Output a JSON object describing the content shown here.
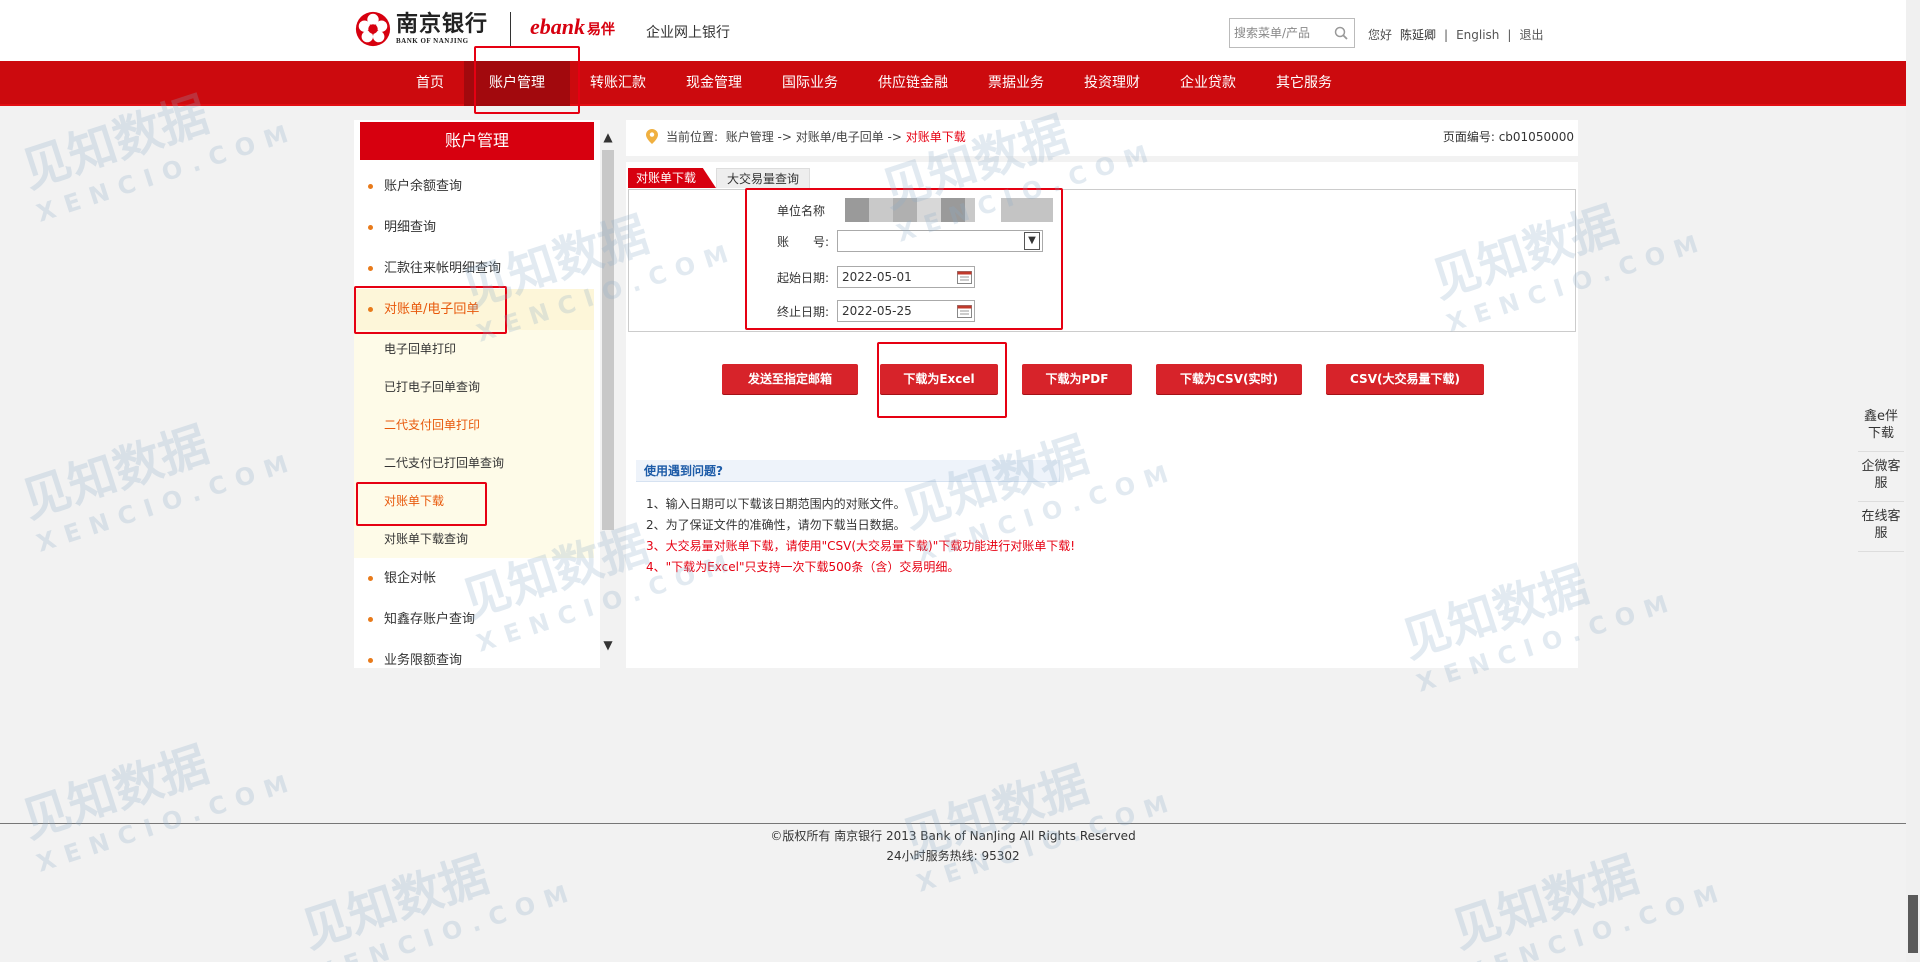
{
  "header": {
    "logo_cn": "南京银行",
    "logo_en": "BANK OF NANJING",
    "ebank_label": "ebank",
    "ebank_tag": "易伴",
    "site_name": "企业网上银行",
    "search_placeholder": "搜索菜单/产品",
    "greeting": "您好",
    "user_name": "陈延卿",
    "lang_link": "English",
    "logout_link": "退出",
    "separator": "|"
  },
  "nav": {
    "items": [
      {
        "label": "首页"
      },
      {
        "label": "账户管理"
      },
      {
        "label": "转账汇款"
      },
      {
        "label": "现金管理"
      },
      {
        "label": "国际业务"
      },
      {
        "label": "供应链金融"
      },
      {
        "label": "票据业务"
      },
      {
        "label": "投资理财"
      },
      {
        "label": "企业贷款"
      },
      {
        "label": "其它服务"
      }
    ],
    "active_index": 1
  },
  "sidebar": {
    "title": "账户管理",
    "items": [
      {
        "label": "账户余额查询"
      },
      {
        "label": "明细查询"
      },
      {
        "label": "汇款往来帐明细查询"
      },
      {
        "label": "对账单/电子回单"
      },
      {
        "label": "银企对帐"
      },
      {
        "label": "知鑫存账户查询"
      },
      {
        "label": "业务限额查询"
      }
    ],
    "sub_items": [
      {
        "label": "电子回单打印"
      },
      {
        "label": "已打电子回单查询"
      },
      {
        "label": "二代支付回单打印"
      },
      {
        "label": "二代支付已打回单查询"
      },
      {
        "label": "对账单下载"
      },
      {
        "label": "对账单下载查询"
      }
    ]
  },
  "breadcrumb": {
    "prefix": "当前位置:",
    "path": "账户管理 -> 对账单/电子回单 ->",
    "current": "对账单下载",
    "page_code": "页面编号: cb01050000"
  },
  "tabs": [
    {
      "label": "对账单下载"
    },
    {
      "label": "大交易量查询"
    }
  ],
  "form": {
    "unit_name_label": "单位名称",
    "account_label": "账　　号:",
    "start_date_label": "起始日期:",
    "start_date_value": "2022-05-01",
    "end_date_label": "终止日期:",
    "end_date_value": "2022-05-25"
  },
  "buttons": {
    "email": "发送至指定邮箱",
    "excel": "下载为Excel",
    "pdf": "下载为PDF",
    "csv_realtime": "下载为CSV(实时)",
    "csv_large": "CSV(大交易量下载)"
  },
  "help": {
    "title": "使用遇到问题?",
    "lines": [
      {
        "text": "1、输入日期可以下载该日期范围内的对账文件。",
        "color": "black"
      },
      {
        "text": "2、为了保证文件的准确性，请勿下载当日数据。",
        "color": "black"
      },
      {
        "text": "3、大交易量对账单下载，请使用\"CSV(大交易量下载)\"下载功能进行对账单下载!",
        "color": "red"
      },
      {
        "text": "4、\"下载为Excel\"只支持一次下载500条（含）交易明细。",
        "color": "red"
      }
    ]
  },
  "footer": {
    "copyright": "©版权所有 南京银行 2013 Bank of NanJing All Rights Reserved",
    "hotline": "24小时服务热线: 95302"
  },
  "float_panel": {
    "items": [
      {
        "label": "鑫e伴下载"
      },
      {
        "label": "企微客服"
      },
      {
        "label": "在线客服"
      }
    ]
  },
  "watermark": {
    "cn": "见知数据",
    "en": "XENCIO.COM"
  },
  "colors": {
    "brand_red": "#d7000f",
    "nav_red": "#cc0a0e",
    "active_nav": "#a2090d",
    "orange_text": "#e8590c",
    "highlight_box": "#e60012"
  }
}
